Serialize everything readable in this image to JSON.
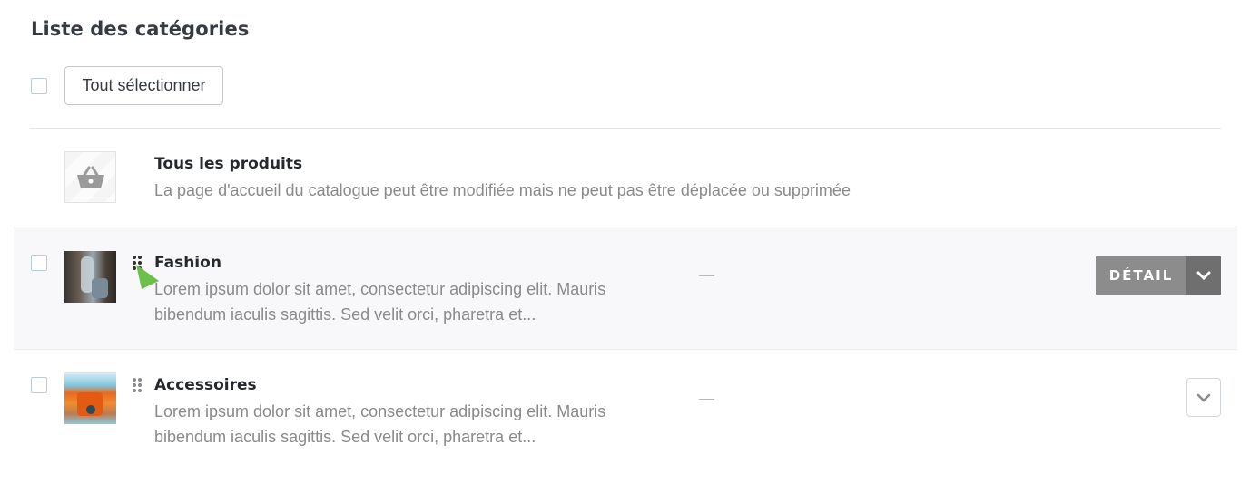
{
  "page": {
    "title": "Liste des catégories"
  },
  "toolbar": {
    "select_all_label": "Tout sélectionner"
  },
  "root_category": {
    "name": "Tous les produits",
    "description": "La page d'accueil du catalogue peut être modifiée mais ne peut pas être déplacée ou supprimée",
    "icon": "basket-icon"
  },
  "categories": [
    {
      "name": "Fashion",
      "description_line1": "Lorem ipsum dolor sit amet, consectetur adipiscing elit. Mauris",
      "description_line2": "bibendum iaculis sagittis. Sed velit orci, pharetra et...",
      "status": "—",
      "detail_label": "DÉTAIL",
      "hovered": true
    },
    {
      "name": "Accessoires",
      "description_line1": "Lorem ipsum dolor sit amet, consectetur adipiscing elit. Mauris",
      "description_line2": "bibendum iaculis sagittis. Sed velit orci, pharetra et...",
      "status": "—"
    }
  ],
  "colors": {
    "hover_row": "#f8f8fa",
    "detail_button": "#8c8c8c",
    "detail_caret": "#6f6f6f",
    "cursor": "#6cc04a"
  }
}
